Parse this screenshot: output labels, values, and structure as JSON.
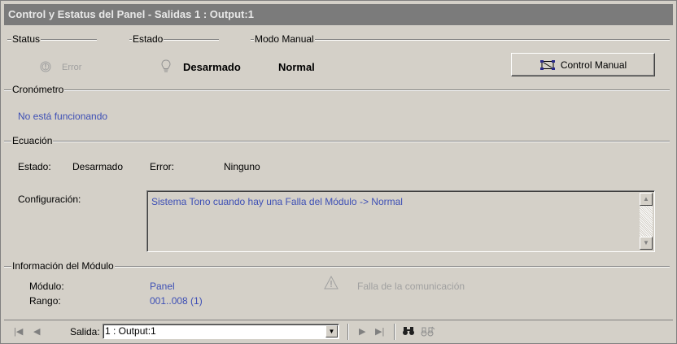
{
  "window": {
    "title": "Control y Estatus del Panel - Salidas 1 : Output:1"
  },
  "status_group": {
    "label": "Status",
    "value": "Error",
    "icon": "error-circle-icon"
  },
  "estado_group": {
    "label": "Estado",
    "value": "Desarmado",
    "icon": "lightbulb-icon"
  },
  "modo_group": {
    "label": "Modo Manual",
    "value": "Normal"
  },
  "control_button": {
    "label": "Control Manual",
    "icon": "network-control-icon"
  },
  "cronometro": {
    "label": "Cronómetro",
    "value": "No está funcionando"
  },
  "ecuacion": {
    "label": "Ecuación",
    "estado_label": "Estado:",
    "estado_value": "Desarmado",
    "error_label": "Error:",
    "error_value": "Ninguno",
    "config_label": "Configuración:",
    "config_value": "Sistema Tono cuando hay una Falla del Módulo -> Normal"
  },
  "modulo": {
    "label": "Información del Módulo",
    "modulo_label": "Módulo:",
    "modulo_value": "Panel",
    "rango_label": "Rango:",
    "rango_value": "001..008 (1)",
    "warning_text": "Falla de la comunicación",
    "warning_icon": "warning-triangle-icon"
  },
  "navbar": {
    "salida_label": "Salida:",
    "salida_value": "1 : Output:1",
    "icons": [
      "first-icon",
      "prev-icon",
      "next-icon",
      "last-icon",
      "find-icon",
      "find-next-icon"
    ]
  },
  "colors": {
    "accent_blue": "#3d4fb5",
    "title_bg": "#7b7b7b",
    "panel_bg": "#d4d0c8"
  }
}
